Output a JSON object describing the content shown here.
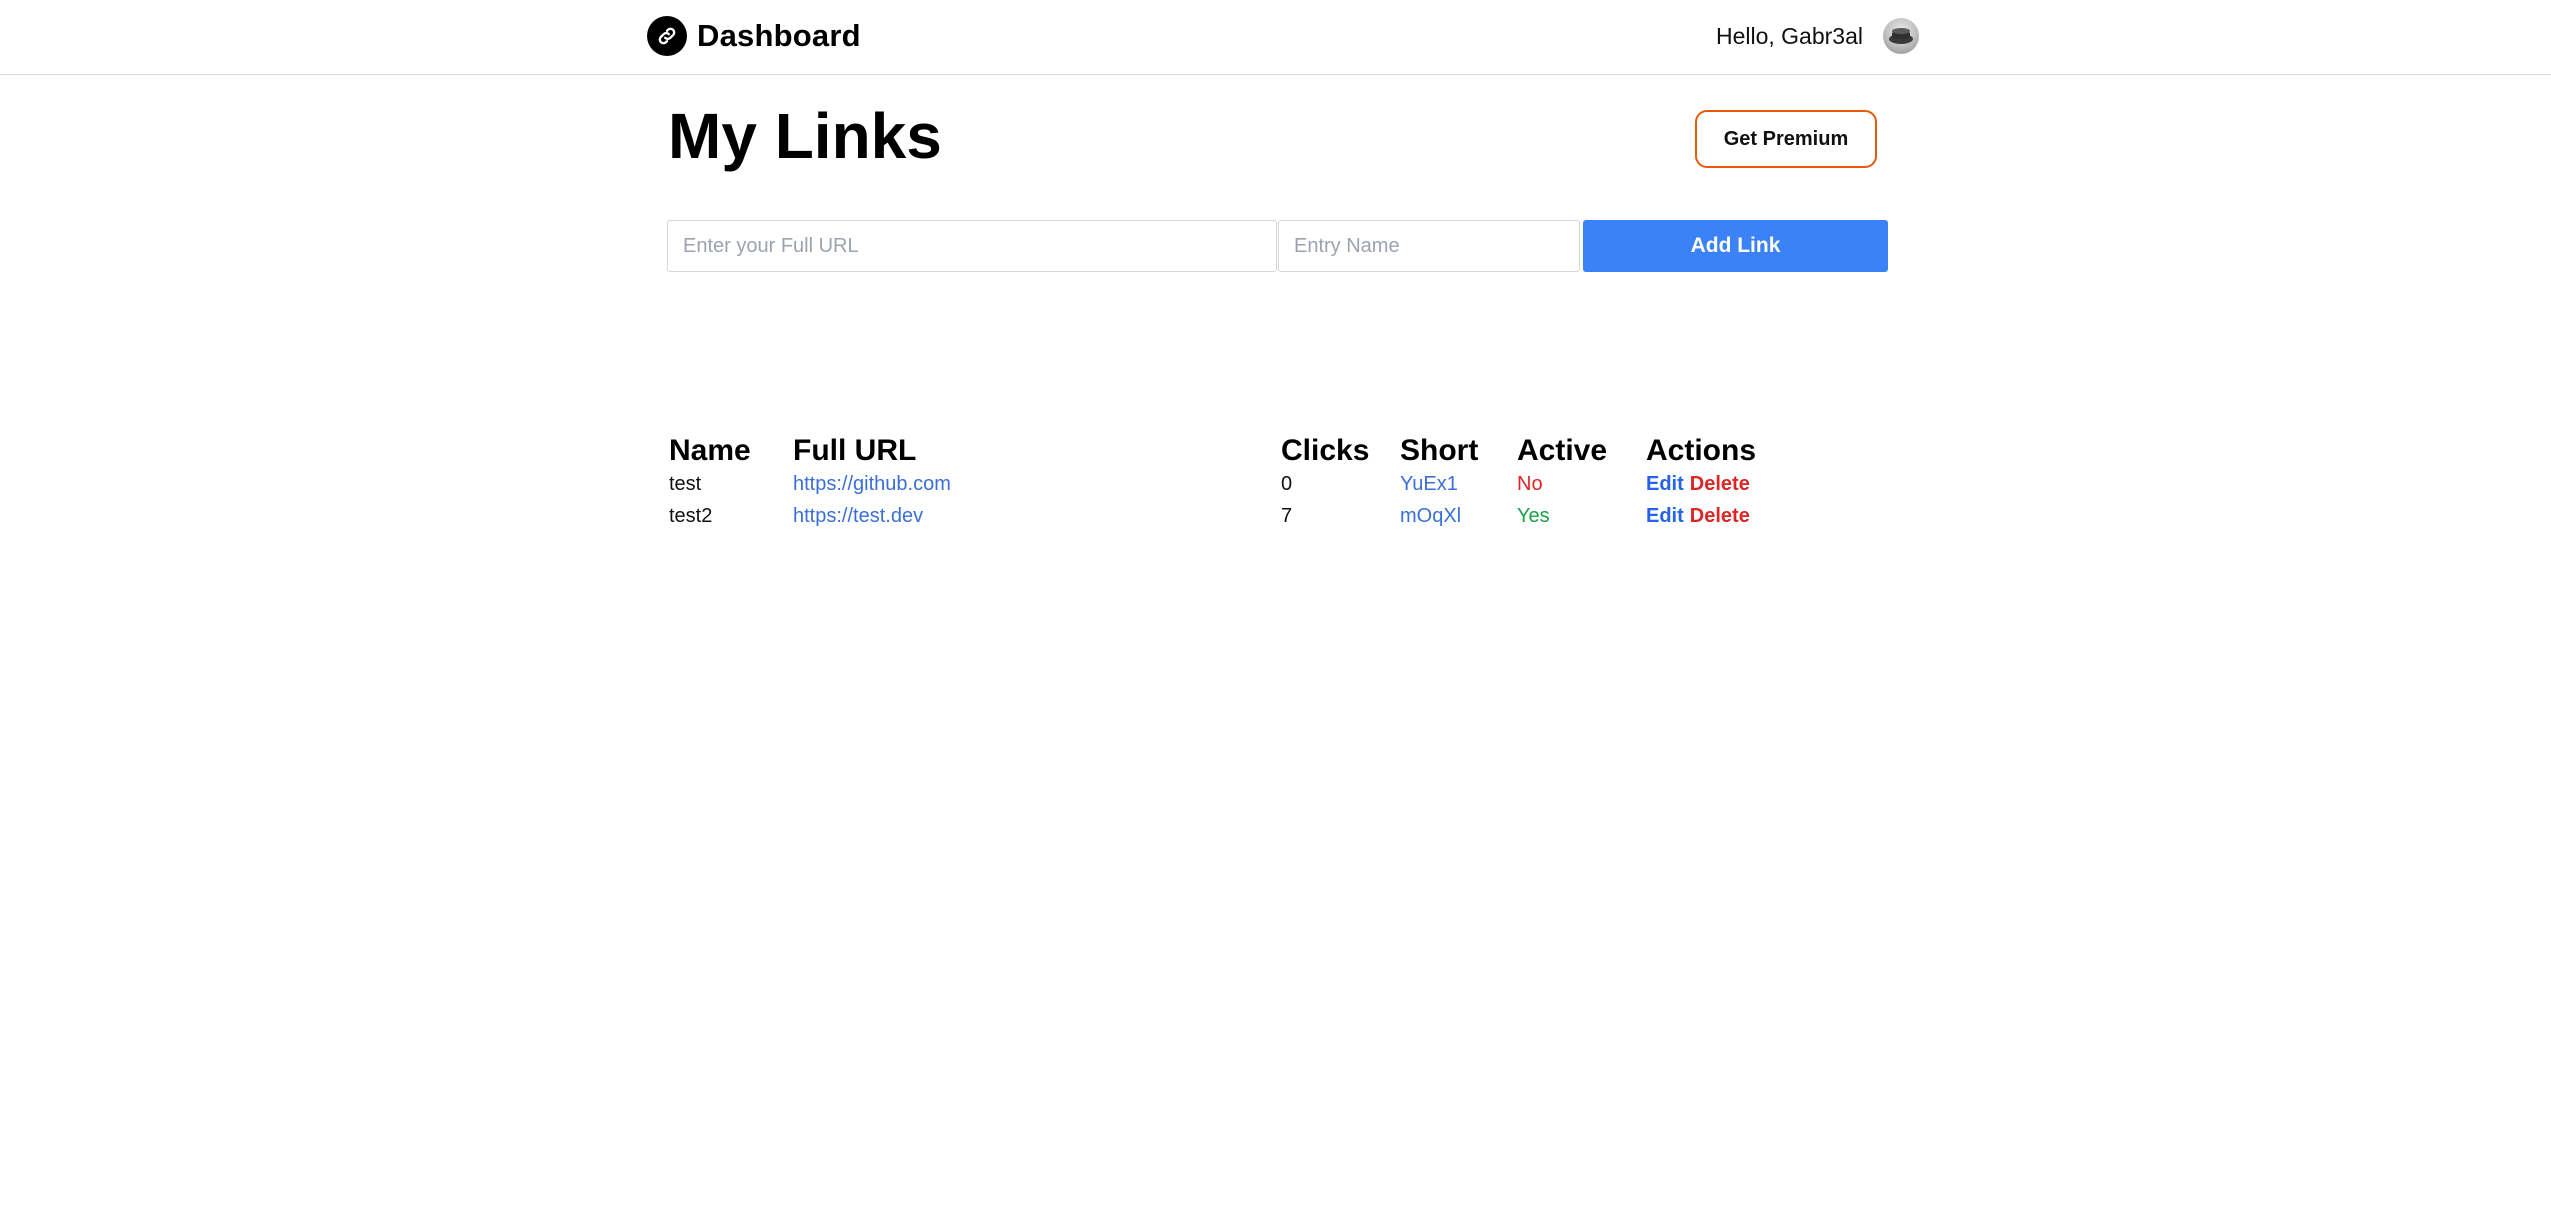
{
  "header": {
    "app_title": "Dashboard",
    "logo_icon": "link-icon",
    "greeting": "Hello, Gabr3al",
    "avatar_icon": "avatar-icon"
  },
  "page": {
    "title": "My Links",
    "premium_label": "Get Premium"
  },
  "form": {
    "url_placeholder": "Enter your Full URL",
    "url_value": "",
    "name_placeholder": "Entry Name",
    "name_value": "",
    "submit_label": "Add Link"
  },
  "table": {
    "headers": [
      "Name",
      "Full URL",
      "Clicks",
      "Short",
      "Active",
      "Actions"
    ],
    "rows": [
      {
        "name": "test",
        "full_url": "https://github.com",
        "clicks": "0",
        "short": "YuEx1",
        "active": "No",
        "edit": "Edit",
        "delete": "Delete"
      },
      {
        "name": "test2",
        "full_url": "https://test.dev",
        "clicks": "7",
        "short": "mOqXl",
        "active": "Yes",
        "edit": "Edit",
        "delete": "Delete"
      }
    ]
  },
  "colors": {
    "accent": "#3b82f6",
    "premium_border": "#ea580c",
    "inactive": "#dc2626",
    "active": "#16a34a"
  }
}
